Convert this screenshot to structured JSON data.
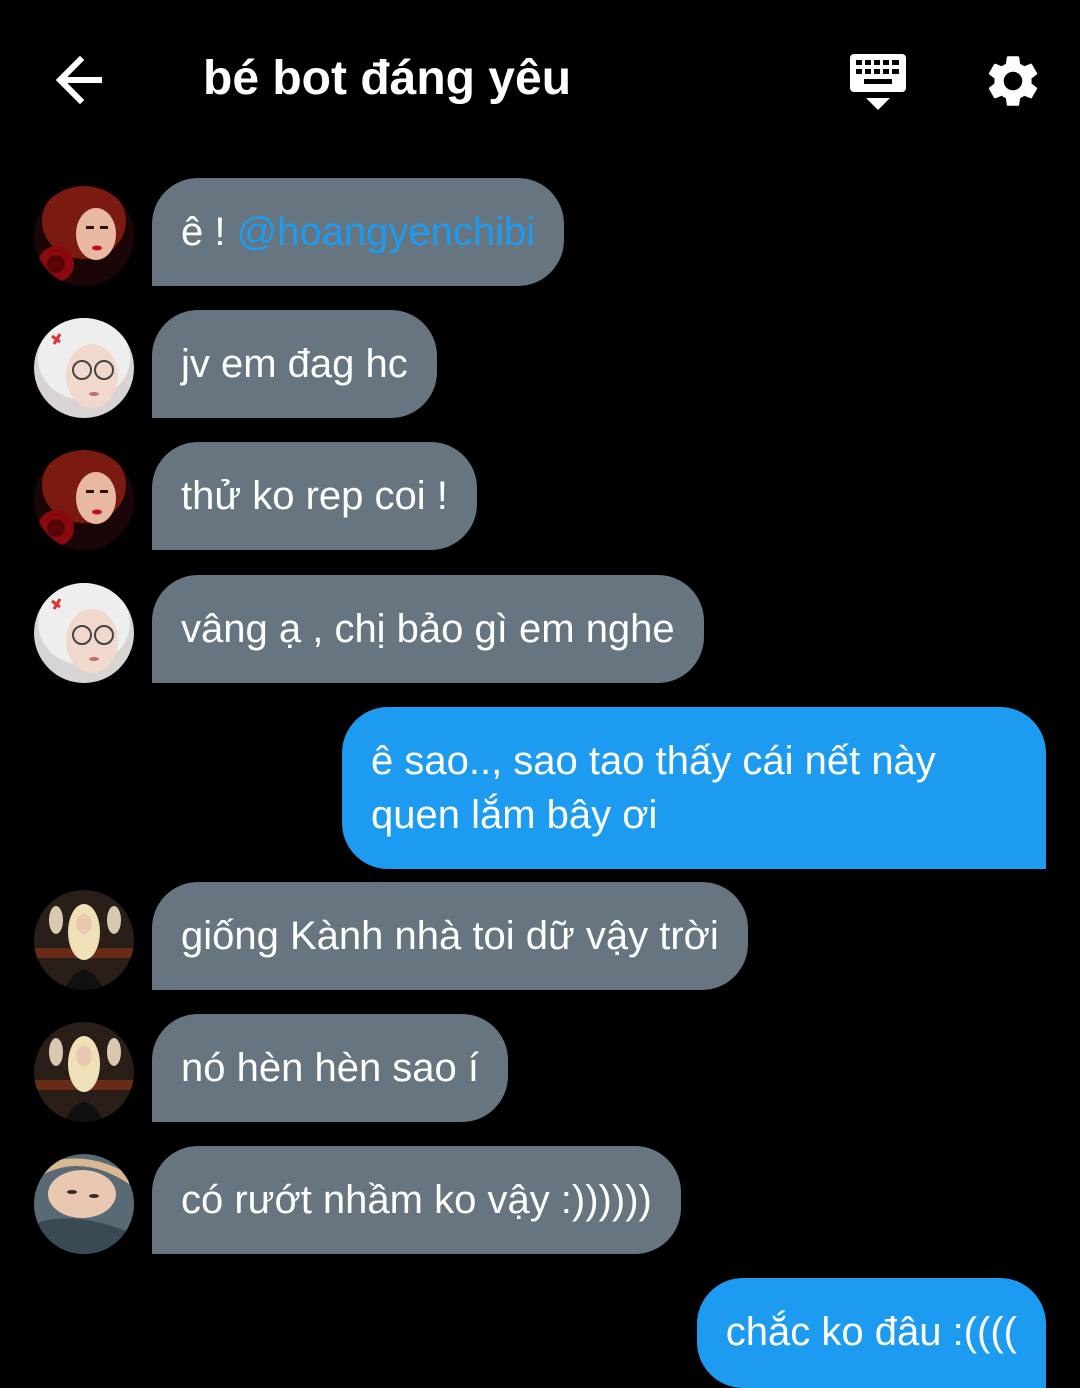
{
  "header": {
    "title": "bé bot đáng yêu",
    "back_icon": "arrow-left-icon",
    "keyboard_icon": "keyboard-hide-icon",
    "settings_icon": "gear-icon"
  },
  "colors": {
    "background": "#000000",
    "received_bubble": "#66757f",
    "sent_bubble": "#1d9bf0",
    "mention": "#1d9bf0"
  },
  "messages": [
    {
      "sender": "received",
      "avatar": "avatar-red-hair",
      "prefix": "ê ! ",
      "mention": "@hoangyenchibi"
    },
    {
      "sender": "received",
      "avatar": "avatar-glasses",
      "text": "jv em đag hc"
    },
    {
      "sender": "received",
      "avatar": "avatar-red-hair",
      "text": "thử ko rep coi !"
    },
    {
      "sender": "received",
      "avatar": "avatar-glasses",
      "text": "vâng ạ , chị bảo gì em nghe"
    },
    {
      "sender": "sent",
      "line1": "ê sao.., sao tao thấy cái nết này",
      "line2": "quen lắm bây ơi"
    },
    {
      "sender": "received",
      "avatar": "avatar-blonde",
      "text": "giống Kành nhà toi dữ vậy trời"
    },
    {
      "sender": "received",
      "avatar": "avatar-blonde",
      "text": "nó hèn hèn sao í"
    },
    {
      "sender": "received",
      "avatar": "avatar-lying",
      "text": "có rướt nhầm ko vậy :))))))"
    },
    {
      "sender": "sent",
      "text": "chắc ko đâu :(((("
    }
  ]
}
